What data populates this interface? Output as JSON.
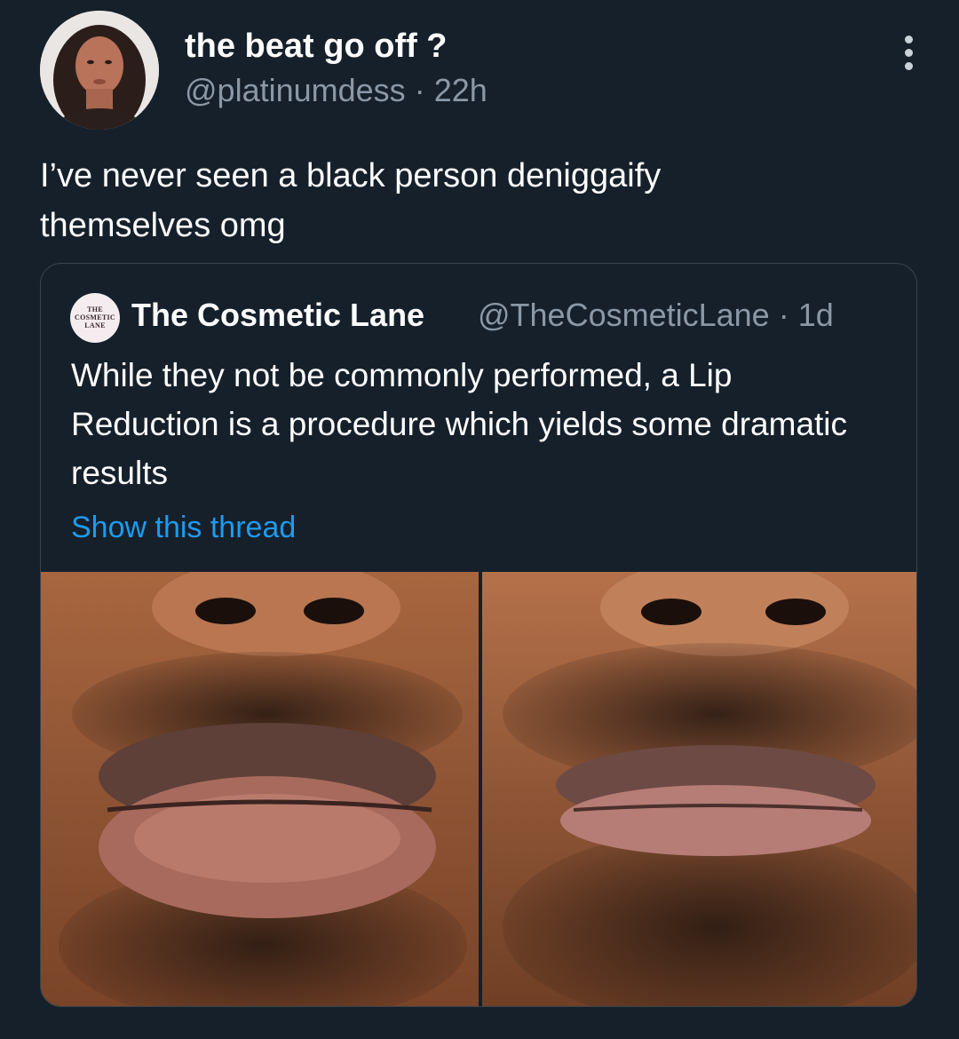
{
  "tweet": {
    "display_name": "the beat go off ?",
    "handle": "@platinumdess",
    "separator": "·",
    "time": "22h",
    "text": "I’ve never seen a black person deniggaify\nthemselves omg",
    "more_icon": "more-vertical-icon"
  },
  "quoted": {
    "avatar_text": "THE\nCOSMETIC\nLANE",
    "display_name": "The Cosmetic Lane",
    "handle": "@TheCosmeticLane",
    "separator": "·",
    "time": "1d",
    "text": "While they not be commonly performed, a Lip Reduction is a procedure which yields some dramatic results",
    "link_label": "Show this thread",
    "media": [
      "before-photo",
      "after-photo"
    ]
  },
  "colors": {
    "background": "#15202b",
    "secondary_text": "#8b98a5",
    "link": "#1d9bf0",
    "border": "#38444d"
  }
}
